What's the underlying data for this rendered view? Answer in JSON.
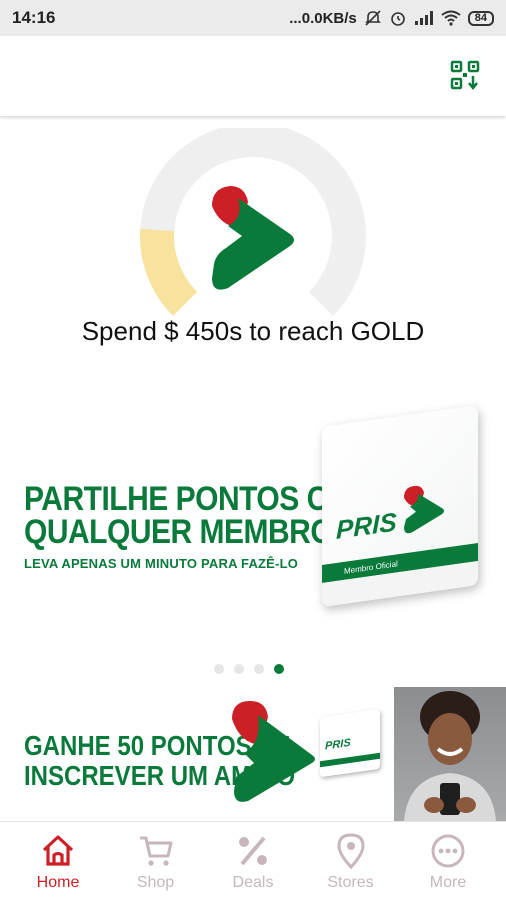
{
  "status_bar": {
    "time": "14:16",
    "net_speed": "...0.0KB/s",
    "battery": "84"
  },
  "header": {
    "qr_icon": "qr-code-download-icon"
  },
  "progress": {
    "message": "Spend $ 450s to reach GOLD",
    "fraction": 0.18,
    "colors": {
      "track": "#efefef",
      "fill": "#f8e39e"
    }
  },
  "carousel": {
    "banner": {
      "line1": "PARTILHE PONTOS COM",
      "line2": "QUALQUER MEMBRO",
      "subtitle": "LEVA APENAS UM MINUTO PARA FAZÊ-LO",
      "card_brand": "PRIS",
      "card_label": "Membro Oficial"
    },
    "dots": 4,
    "active_dot": 3
  },
  "promo": {
    "line1": "GANHE 50 PONTOS SE",
    "line2": "INSCREVER UM AMIGO",
    "card_brand": "PRIS"
  },
  "nav": [
    {
      "label": "Home",
      "icon": "home-icon",
      "active": true
    },
    {
      "label": "Shop",
      "icon": "cart-icon",
      "active": false
    },
    {
      "label": "Deals",
      "icon": "percent-icon",
      "active": false
    },
    {
      "label": "Stores",
      "icon": "location-pin-icon",
      "active": false
    },
    {
      "label": "More",
      "icon": "more-icon",
      "active": false
    }
  ],
  "colors": {
    "brand_green": "#0a7a3b",
    "brand_red": "#cc1f26",
    "nav_inactive": "#c7b6bc"
  }
}
